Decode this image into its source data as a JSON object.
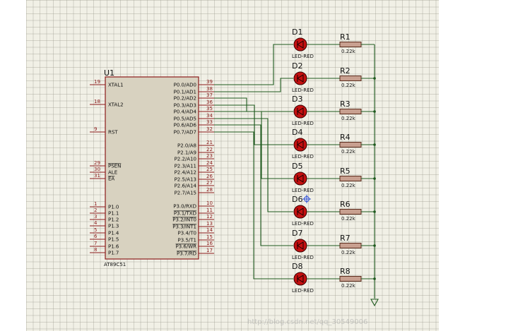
{
  "chip": {
    "ref": "U1",
    "part": "AT89C51",
    "left_pins": [
      {
        "num": "19",
        "name": "XTAL1"
      },
      {
        "num": "18",
        "name": "XTAL2"
      },
      {
        "num": "9",
        "name": "RST"
      },
      {
        "num": "29",
        "name": "PSEN"
      },
      {
        "num": "30",
        "name": "ALE"
      },
      {
        "num": "31",
        "name": "EA"
      },
      {
        "num": "1",
        "name": "P1.0"
      },
      {
        "num": "2",
        "name": "P1.1"
      },
      {
        "num": "3",
        "name": "P1.2"
      },
      {
        "num": "4",
        "name": "P1.3"
      },
      {
        "num": "5",
        "name": "P1.4"
      },
      {
        "num": "6",
        "name": "P1.5"
      },
      {
        "num": "7",
        "name": "P1.6"
      },
      {
        "num": "8",
        "name": "P1.7"
      }
    ],
    "right_pins": [
      {
        "num": "39",
        "name": "P0.0/AD0"
      },
      {
        "num": "38",
        "name": "P0.1/AD1"
      },
      {
        "num": "37",
        "name": "P0.2/AD2"
      },
      {
        "num": "36",
        "name": "P0.3/AD3"
      },
      {
        "num": "35",
        "name": "P0.4/AD4"
      },
      {
        "num": "34",
        "name": "P0.5/AD5"
      },
      {
        "num": "33",
        "name": "P0.6/AD6"
      },
      {
        "num": "32",
        "name": "P0.7/AD7"
      },
      {
        "num": "21",
        "name": "P2.0/A8"
      },
      {
        "num": "22",
        "name": "P2.1/A9"
      },
      {
        "num": "23",
        "name": "P2.2/A10"
      },
      {
        "num": "24",
        "name": "P2.3/A11"
      },
      {
        "num": "25",
        "name": "P2.4/A12"
      },
      {
        "num": "26",
        "name": "P2.5/A13"
      },
      {
        "num": "27",
        "name": "P2.6/A14"
      },
      {
        "num": "28",
        "name": "P2.7/A15"
      },
      {
        "num": "10",
        "name": "P3.0/RXD"
      },
      {
        "num": "11",
        "name": "P3.1/TXD"
      },
      {
        "num": "12",
        "name": "P3.2/INT0"
      },
      {
        "num": "13",
        "name": "P3.3/INT1"
      },
      {
        "num": "14",
        "name": "P3.4/T0"
      },
      {
        "num": "15",
        "name": "P3.5/T1"
      },
      {
        "num": "16",
        "name": "P3.6/WR"
      },
      {
        "num": "17",
        "name": "P3.7/RD"
      }
    ]
  },
  "leds": [
    {
      "ref": "D1",
      "type": "LED-RED"
    },
    {
      "ref": "D2",
      "type": "LED-RED"
    },
    {
      "ref": "D3",
      "type": "LED-RED"
    },
    {
      "ref": "D4",
      "type": "LED-RED"
    },
    {
      "ref": "D5",
      "type": "LED-RED"
    },
    {
      "ref": "D6",
      "type": "LED-RED"
    },
    {
      "ref": "D7",
      "type": "LED-RED"
    },
    {
      "ref": "D8",
      "type": "LED-RED"
    }
  ],
  "resistors": [
    {
      "ref": "R1",
      "value": "0.22k"
    },
    {
      "ref": "R2",
      "value": "0.22k"
    },
    {
      "ref": "R3",
      "value": "0.22k"
    },
    {
      "ref": "R4",
      "value": "0.22k"
    },
    {
      "ref": "R5",
      "value": "0.22k"
    },
    {
      "ref": "R6",
      "value": "0.22k"
    },
    {
      "ref": "R7",
      "value": "0.22k"
    },
    {
      "ref": "R8",
      "value": "0.22k"
    }
  ],
  "colors": {
    "wire": "#1e5a1e",
    "chip_border": "#8b1a1a",
    "chip_fill": "#d8d2c0",
    "led_fill": "#c41010",
    "resistor_fill": "#c8a090",
    "label_ref": "#111111",
    "pin_num": "#8b1a1a",
    "cursor_marker": "#2a4cd6"
  },
  "watermark": "http://blog.csdn.net/qq_30549006"
}
